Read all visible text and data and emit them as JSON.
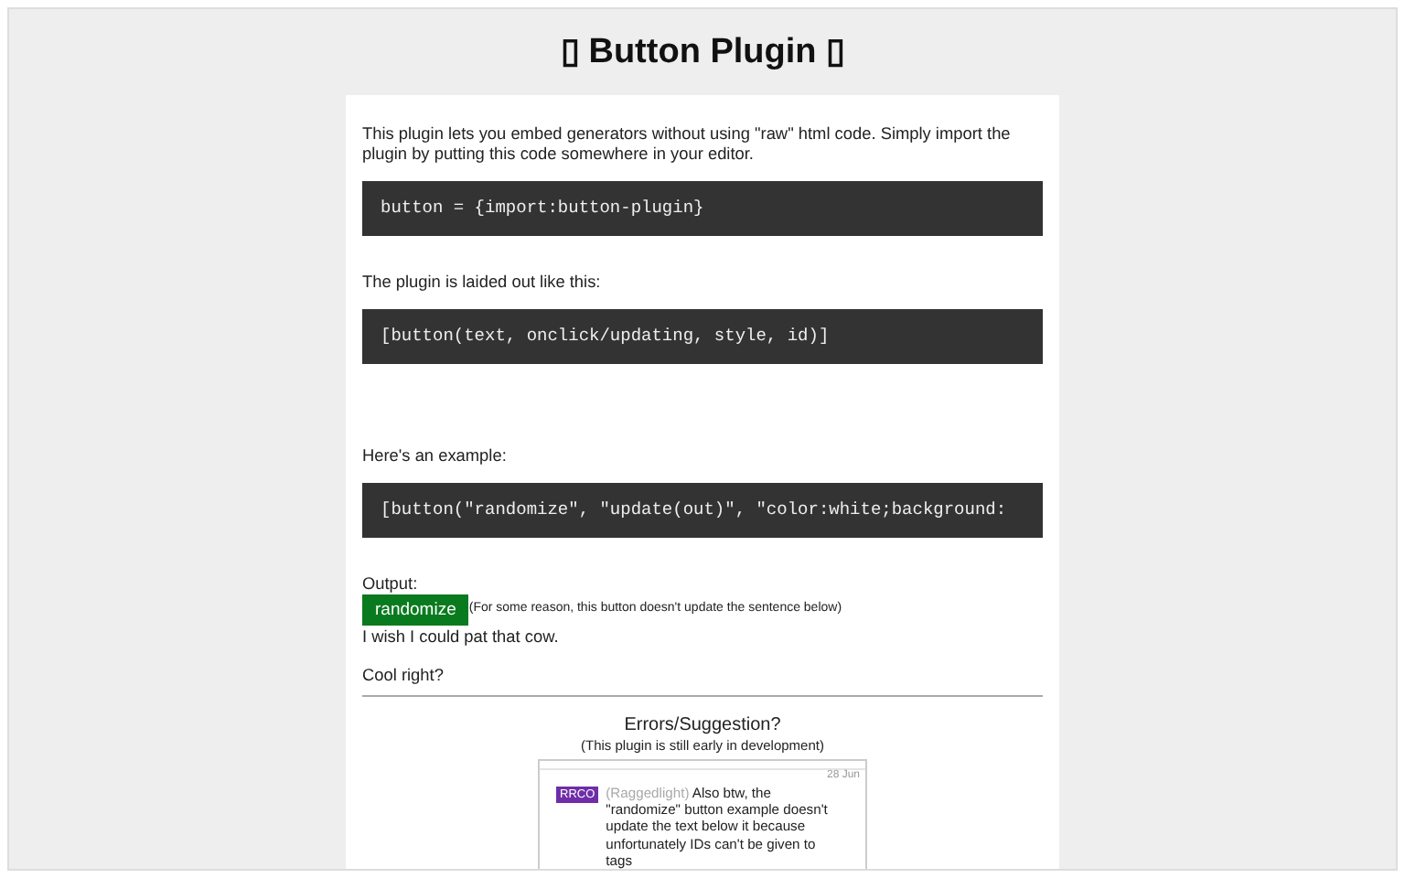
{
  "title": "▯ Button Plugin ▯",
  "blocks": [
    {
      "kind": "text",
      "text": "This plugin lets you embed generators without using \"raw\" html code. Simply import the plugin by putting this code somewhere in your editor."
    },
    {
      "kind": "code",
      "text": "button = {import:button-plugin}"
    },
    {
      "kind": "text",
      "text": "The plugin is laided out like this:"
    },
    {
      "kind": "code",
      "text": "[button(text, onclick/updating, style, id)]"
    },
    {
      "kind": "gap"
    },
    {
      "kind": "text",
      "text": "Here's an example:"
    },
    {
      "kind": "code",
      "text": "[button(\"randomize\", \"update(out)\", \"color:white;background:"
    }
  ],
  "output": {
    "label": "Output:",
    "button": "randomize",
    "note": "(For some reason, this button doesn't update the sentence below)",
    "sentence": "I wish I could pat that cow."
  },
  "closing": "Cool right?",
  "feedback": {
    "heading": "Errors/Suggestion?",
    "subheading": "(This plugin is still early in development)",
    "comment": {
      "tag": "RRCO",
      "author": "(Raggedlight)",
      "text": "Also btw, the \"randomize\" button example doesn't update the text below it because unfortunately IDs can't be given to tags",
      "date": "28 Jun",
      "color": "#6f2da8"
    }
  }
}
